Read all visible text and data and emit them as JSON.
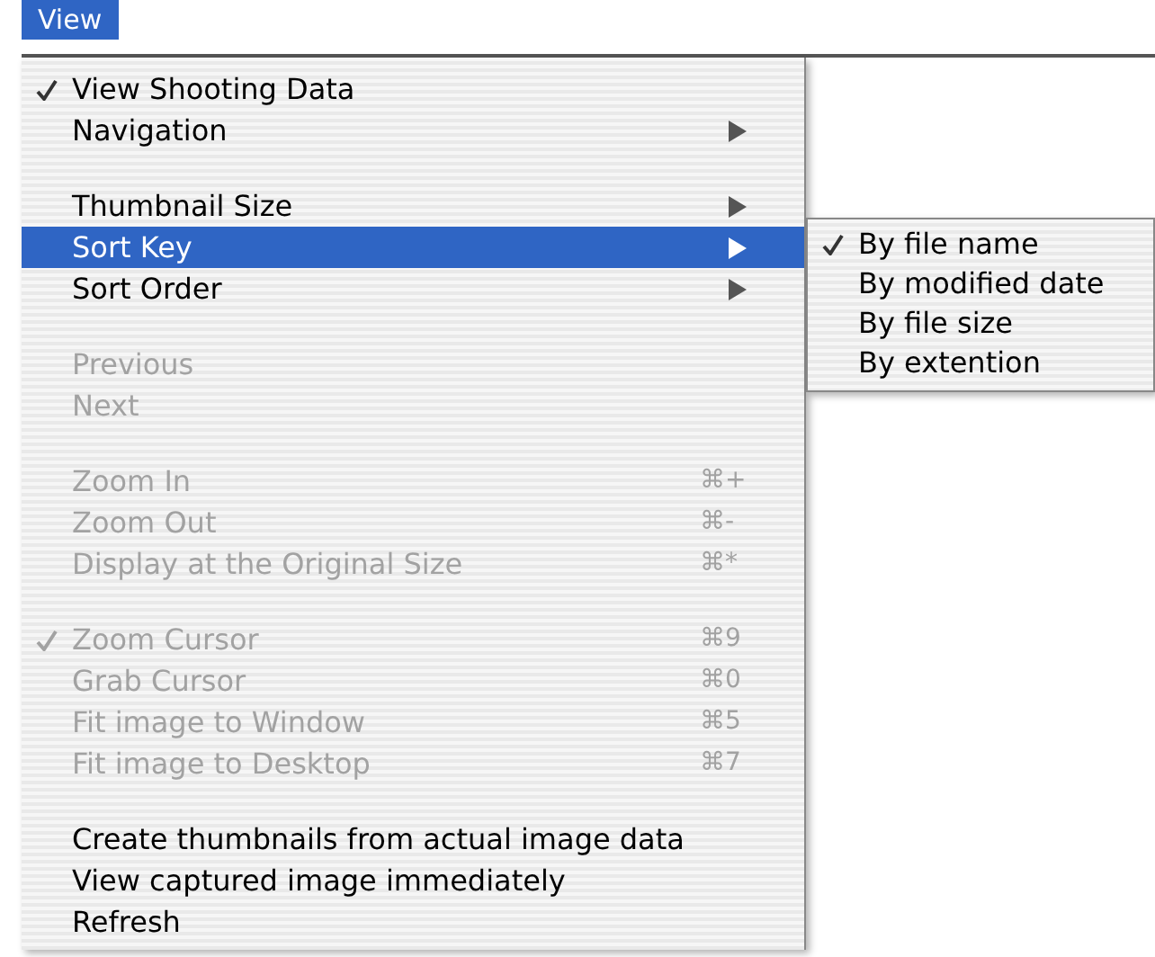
{
  "menu_bar": [
    {
      "label": "View",
      "selected": true
    }
  ],
  "menu": {
    "items": [
      {
        "kind": "item",
        "label": "View Shooting Data",
        "checked": true,
        "disabled": false,
        "selected": false,
        "has_submenu": false
      },
      {
        "kind": "item",
        "label": "Navigation",
        "checked": false,
        "disabled": false,
        "selected": false,
        "has_submenu": true
      },
      {
        "kind": "separator"
      },
      {
        "kind": "item",
        "label": "Thumbnail Size",
        "checked": false,
        "disabled": false,
        "selected": false,
        "has_submenu": true
      },
      {
        "kind": "item",
        "label": "Sort Key",
        "checked": false,
        "disabled": false,
        "selected": true,
        "has_submenu": true
      },
      {
        "kind": "item",
        "label": "Sort Order",
        "checked": false,
        "disabled": false,
        "selected": false,
        "has_submenu": true
      },
      {
        "kind": "separator"
      },
      {
        "kind": "item",
        "label": "Previous",
        "checked": false,
        "disabled": true,
        "selected": false,
        "has_submenu": false
      },
      {
        "kind": "item",
        "label": "Next",
        "checked": false,
        "disabled": true,
        "selected": false,
        "has_submenu": false
      },
      {
        "kind": "separator"
      },
      {
        "kind": "item",
        "label": "Zoom In",
        "checked": false,
        "disabled": true,
        "selected": false,
        "has_submenu": false,
        "shortcut": "⌘+"
      },
      {
        "kind": "item",
        "label": "Zoom Out",
        "checked": false,
        "disabled": true,
        "selected": false,
        "has_submenu": false,
        "shortcut": "⌘-"
      },
      {
        "kind": "item",
        "label": "Display at the Original Size",
        "checked": false,
        "disabled": true,
        "selected": false,
        "has_submenu": false,
        "shortcut": "⌘*"
      },
      {
        "kind": "separator"
      },
      {
        "kind": "item",
        "label": "Zoom Cursor",
        "checked": true,
        "disabled": true,
        "selected": false,
        "has_submenu": false,
        "shortcut": "⌘9"
      },
      {
        "kind": "item",
        "label": "Grab Cursor",
        "checked": false,
        "disabled": true,
        "selected": false,
        "has_submenu": false,
        "shortcut": "⌘0"
      },
      {
        "kind": "item",
        "label": "Fit image to Window",
        "checked": false,
        "disabled": true,
        "selected": false,
        "has_submenu": false,
        "shortcut": "⌘5"
      },
      {
        "kind": "item",
        "label": "Fit image to Desktop",
        "checked": false,
        "disabled": true,
        "selected": false,
        "has_submenu": false,
        "shortcut": "⌘7"
      },
      {
        "kind": "separator"
      },
      {
        "kind": "item",
        "label": "Create thumbnails from actual image data",
        "checked": false,
        "disabled": false,
        "selected": false,
        "has_submenu": false
      },
      {
        "kind": "item",
        "label": "View captured image immediately",
        "checked": false,
        "disabled": false,
        "selected": false,
        "has_submenu": false
      },
      {
        "kind": "item",
        "label": "Refresh",
        "checked": false,
        "disabled": false,
        "selected": false,
        "has_submenu": false
      }
    ]
  },
  "submenu": {
    "items": [
      {
        "label": "By file name",
        "checked": true
      },
      {
        "label": "By modified date",
        "checked": false
      },
      {
        "label": "By file size",
        "checked": false
      },
      {
        "label": "By extention",
        "checked": false
      }
    ]
  }
}
